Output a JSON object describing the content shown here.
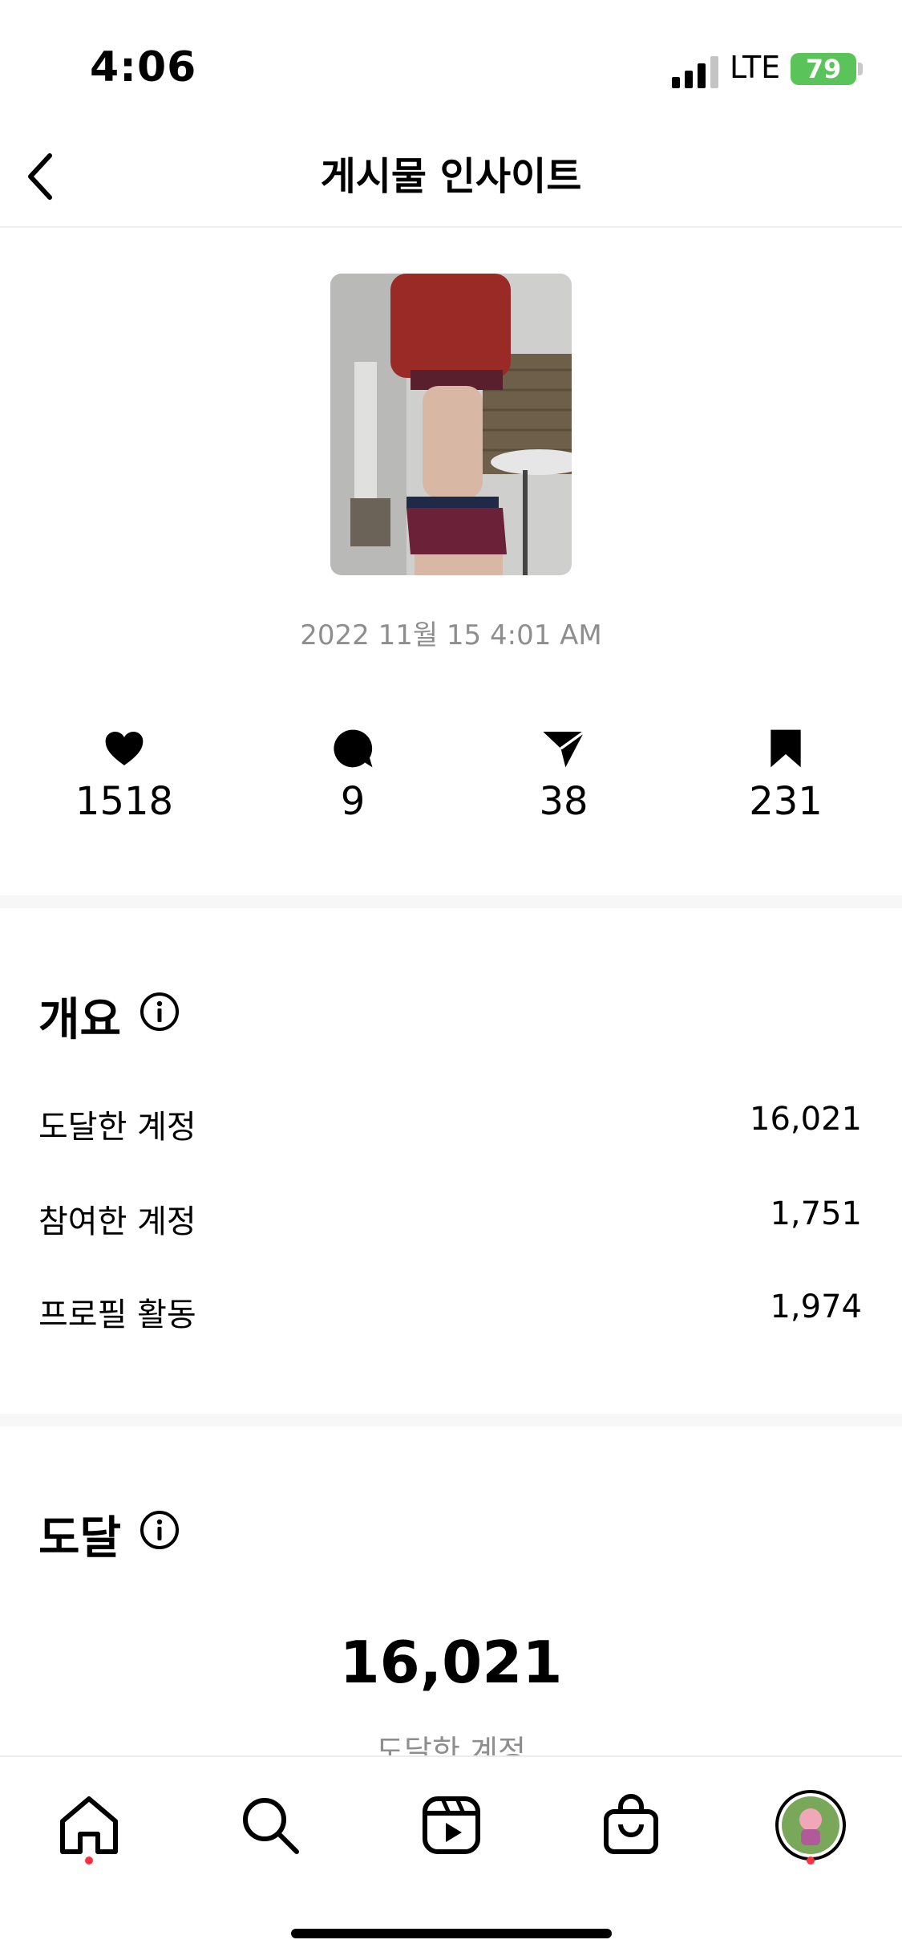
{
  "status_bar": {
    "time": "4:06",
    "carrier": "LTE",
    "battery": "79"
  },
  "header": {
    "title": "게시물 인사이트"
  },
  "post": {
    "date": "2022 11월 15 4:01 AM"
  },
  "stats": {
    "likes": "1518",
    "comments": "9",
    "shares": "38",
    "saves": "231"
  },
  "overview": {
    "title": "개요",
    "rows": [
      {
        "label": "도달한 계정",
        "value": "16,021"
      },
      {
        "label": "참여한 계정",
        "value": "1,751"
      },
      {
        "label": "프로필 활동",
        "value": "1,974"
      }
    ]
  },
  "reach": {
    "title": "도달",
    "value": "16,021",
    "caption": "도달한 계정"
  },
  "colors": {
    "accent_red": "#ff3040",
    "battery_green": "#5ac35a",
    "muted_text": "#8e8e8e"
  },
  "tabs": [
    "home-icon",
    "search-icon",
    "reels-icon",
    "shop-icon",
    "profile-avatar"
  ]
}
